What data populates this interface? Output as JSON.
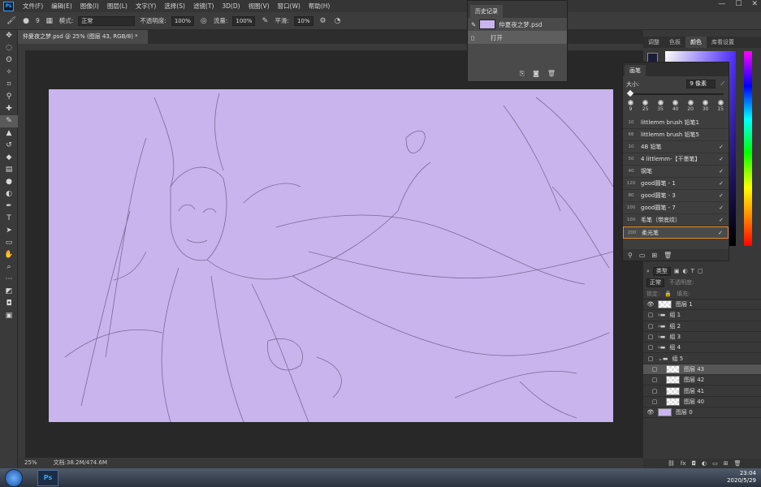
{
  "menubar": {
    "logo": "Ps",
    "items": [
      "文件(F)",
      "编辑(E)",
      "图像(I)",
      "图层(L)",
      "文字(Y)",
      "选择(S)",
      "滤镜(T)",
      "3D(D)",
      "视图(V)",
      "窗口(W)",
      "帮助(H)"
    ],
    "controls": [
      "—",
      "☐",
      "✕"
    ]
  },
  "options": {
    "brush_size": "9",
    "mode_label": "模式:",
    "mode_value": "正常",
    "opacity_label": "不透明度:",
    "opacity_value": "100%",
    "flow_label": "流量:",
    "flow_value": "100%",
    "smooth_label": "平滑:",
    "smooth_value": "10%"
  },
  "document": {
    "tab_title": "仲夏夜之梦.psd @ 25% (图层 43, RGB/8) *",
    "canvas_color": "#c9b4ee"
  },
  "status": {
    "zoom": "25%",
    "doc_size": "文档:38.2M/474.6M"
  },
  "history": {
    "title": "历史记录",
    "snapshot": "仲夏夜之梦.psd",
    "states": [
      "打开"
    ]
  },
  "color_panel": {
    "tabs": [
      "调整",
      "色板",
      "颜色",
      "库看设置"
    ],
    "active": "颜色",
    "foreground": "#1b1c3a"
  },
  "brush": {
    "title": "画笔",
    "size_label": "大小:",
    "size_value": "9 像素",
    "presets": [
      "9",
      "25",
      "35",
      "40",
      "20",
      "30",
      "15"
    ],
    "list": [
      {
        "num": "10",
        "name": "littlemm brush 铅笔1"
      },
      {
        "num": "66",
        "name": "littlemm brush 铅笔5"
      },
      {
        "num": "10",
        "name": "4B 铅笔"
      },
      {
        "num": "50",
        "name": "4 littlemm-【干墨笔】"
      },
      {
        "num": "40",
        "name": "钢笔"
      },
      {
        "num": "120",
        "name": "good圆笔 - 1"
      },
      {
        "num": "80",
        "name": "good圆笔 - 3"
      },
      {
        "num": "100",
        "name": "good圆笔 - 7"
      },
      {
        "num": "100",
        "name": "毛笔（带底纹）"
      },
      {
        "num": "200",
        "name": "柔光笔"
      }
    ]
  },
  "layers": {
    "filter": "类型",
    "mode": "正常",
    "opacity_label": "不透明度:",
    "lock_label": "锁定:",
    "fill_label": "填充:",
    "rows": [
      {
        "name": "图层 1",
        "type": "layer",
        "visible": true
      },
      {
        "name": "组 1",
        "type": "group",
        "visible": false
      },
      {
        "name": "组 2",
        "type": "group",
        "visible": false
      },
      {
        "name": "组 3",
        "type": "group",
        "visible": false
      },
      {
        "name": "组 4",
        "type": "group",
        "visible": false
      },
      {
        "name": "组 5",
        "type": "group",
        "visible": false
      },
      {
        "name": "图层 43",
        "type": "layer",
        "visible": false
      },
      {
        "name": "图层 42",
        "type": "layer",
        "visible": false
      },
      {
        "name": "图层 41",
        "type": "layer",
        "visible": false
      },
      {
        "name": "图层 40",
        "type": "layer",
        "visible": false
      },
      {
        "name": "图层 0",
        "type": "fill",
        "visible": true
      }
    ],
    "selected": "图层 43"
  },
  "taskbar": {
    "app": "Ps",
    "time": "23:04",
    "date": "2020/5/29"
  }
}
